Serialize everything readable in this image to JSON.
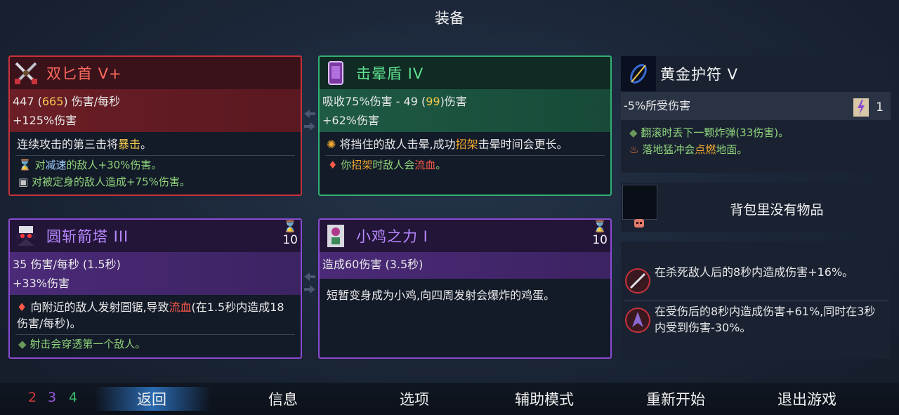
{
  "screen_title": "装备",
  "dagger": {
    "name": "双匕首 V+",
    "dps_base": "447 (",
    "dps_bonus": "665",
    "dps_suffix": ") 伤害/每秒",
    "damage_bonus": "+125%伤害",
    "desc_a": "连续攻击的第三击将",
    "desc_b": "暴击",
    "desc_c": "。",
    "trait1_a": "对",
    "trait1_b": "减速",
    "trait1_c": "的敌人+30%伤害。",
    "trait2": "对被定身的敌人造成+75%伤害。"
  },
  "shield": {
    "name": "击晕盾 IV",
    "stat_a": "吸收75%伤害 - 49 (",
    "stat_b": "99",
    "stat_c": ")伤害",
    "damage_bonus": "+62%伤害",
    "desc_a": "将挡住的敌人击晕,成功",
    "desc_b": "招架",
    "desc_c": "击晕时间会更长。",
    "trait_a": "你",
    "trait_b": "招架",
    "trait_c": "时敌人会",
    "trait_d": "流血",
    "trait_e": "。"
  },
  "amulet": {
    "name": "黄金护符 V",
    "stat": "-5%所受伤害",
    "scroll_count": "1",
    "trait1": "翻滚时丢下一颗炸弹(33伤害)。",
    "trait2_a": "落地猛冲会",
    "trait2_b": "点燃",
    "trait2_c": "地面。"
  },
  "turret": {
    "name": "圆斩箭塔 III",
    "cooldown": "10",
    "dps": "35 伤害/每秒 (1.5秒)",
    "damage_bonus": "+33%伤害",
    "desc_a": "向附近的敌人发射圆锯,导致",
    "desc_b": "流血",
    "desc_c": "(在1.5秒内造成18伤害/每秒)。",
    "trait": "射击会穿透第一个敌人。"
  },
  "chicken": {
    "name": "小鸡之力 I",
    "cooldown": "10",
    "stat": "造成60伤害 (3.5秒)",
    "desc": "短暂变身成为小鸡,向四周发射会爆炸的鸡蛋。"
  },
  "backpack": {
    "empty_text": "背包里没有物品"
  },
  "mutations": [
    {
      "text": "在杀死敌人后的8秒内造成伤害+16%。"
    },
    {
      "text": "在受伤后的8秒内造成伤害+61%,同时在3秒内受到伤害-30%。"
    }
  ],
  "stats": {
    "brutality": "2",
    "tactics": "3",
    "survival": "4"
  },
  "nav": {
    "back": "返回",
    "info": "信息",
    "options": "选项",
    "assist": "辅助模式",
    "restart": "重新开始",
    "quit": "退出游戏"
  },
  "colors": {
    "brutality": "#d03a3a",
    "tactics": "#9a5ae0",
    "survival": "#3cc070",
    "highlight_yellow": "#f2c94c",
    "highlight_red": "#ff5a4a"
  }
}
